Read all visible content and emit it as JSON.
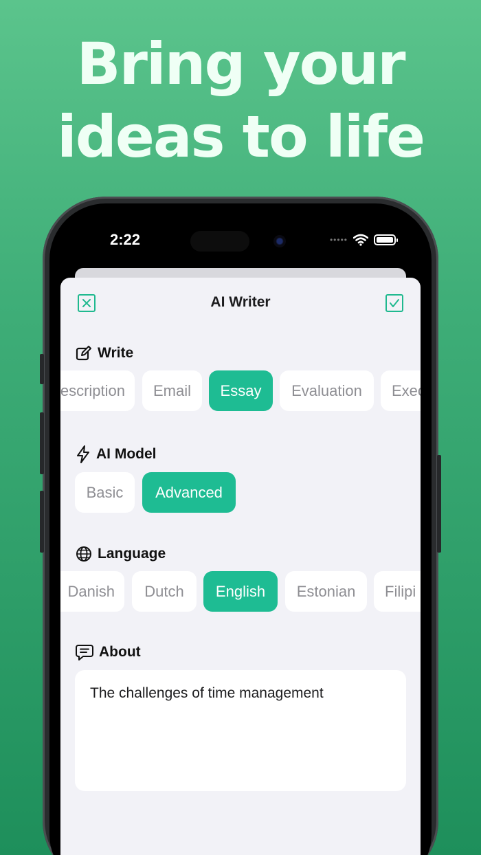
{
  "headline": {
    "line1": "Bring your",
    "line2": "ideas to life"
  },
  "status_bar": {
    "time": "2:22",
    "dots": "•••••"
  },
  "sheet": {
    "title": "AI Writer"
  },
  "write": {
    "label": "Write",
    "options": [
      "escription",
      "Email",
      "Essay",
      "Evaluation",
      "Exec"
    ],
    "selected": "Essay"
  },
  "ai_model": {
    "label": "AI Model",
    "options": [
      "Basic",
      "Advanced"
    ],
    "selected": "Advanced"
  },
  "language": {
    "label": "Language",
    "options": [
      "Danish",
      "Dutch",
      "English",
      "Estonian",
      "Filipi"
    ],
    "selected": "English"
  },
  "about": {
    "label": "About",
    "value": "The challenges of time management"
  },
  "colors": {
    "accent": "#1ebc93",
    "background_top": "#5bc48c",
    "background_bottom": "#1e8f5b"
  }
}
